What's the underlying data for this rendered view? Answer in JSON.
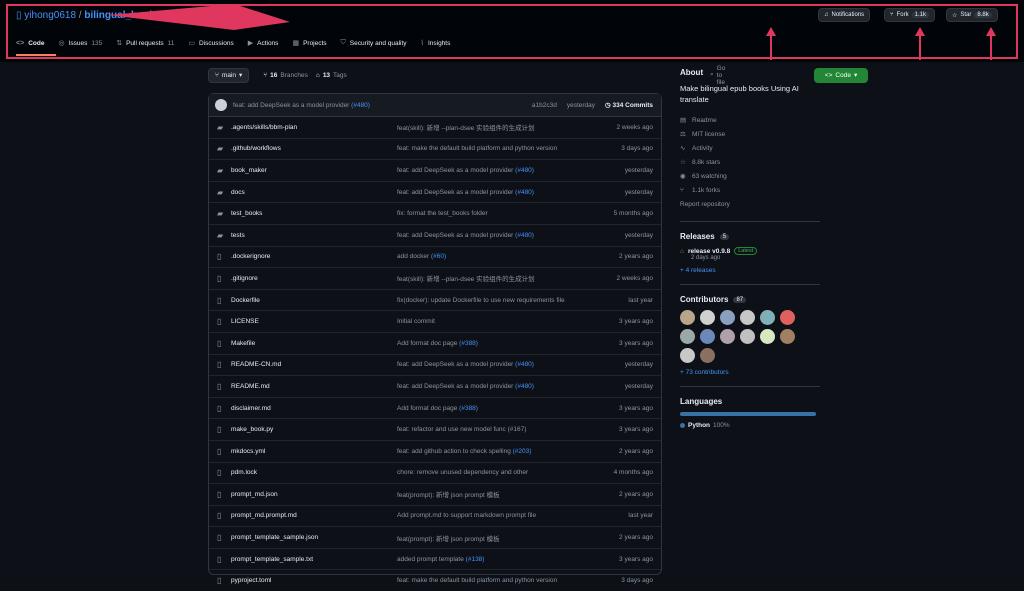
{
  "repo": {
    "owner": "yihong0618",
    "separator": "/",
    "name": "bilingual_book_maker"
  },
  "header_buttons": {
    "notifications": "Notifications",
    "fork_label": "Fork",
    "fork_count": "1.1k",
    "star_label": "Star",
    "star_count": "8.8k"
  },
  "tabs": [
    {
      "label": "Code",
      "count": ""
    },
    {
      "label": "Issues",
      "count": "135"
    },
    {
      "label": "Pull requests",
      "count": "11"
    },
    {
      "label": "Discussions",
      "count": ""
    },
    {
      "label": "Actions",
      "count": ""
    },
    {
      "label": "Projects",
      "count": ""
    },
    {
      "label": "Security and quality",
      "count": ""
    },
    {
      "label": "Insights",
      "count": ""
    }
  ],
  "branchbar": {
    "branch": "main",
    "branches_count": "16",
    "branches_label": "Branches",
    "tags_count": "13",
    "tags_label": "Tags",
    "goto_file": "Go to file",
    "code_button": "Code"
  },
  "latest_commit": {
    "author": "...",
    "message": "feat: add DeepSeek as a model provider",
    "pr": "(#480)",
    "hash": "a1b2c3d",
    "time": "yesterday",
    "commits": "334 Commits"
  },
  "files": [
    {
      "type": "dir",
      "name": ".agents/skills/bbm-plan",
      "msg": "feat(skill): 新增 --plan-dsee 实验组件的生成计划",
      "pr": "",
      "time": "2 weeks ago"
    },
    {
      "type": "dir",
      "name": ".github/workflows",
      "msg": "feat: make the default build platform and python version",
      "pr": "",
      "time": "3 days ago"
    },
    {
      "type": "dir",
      "name": "book_maker",
      "msg": "feat: add DeepSeek as a model provider",
      "pr": "(#480)",
      "time": "yesterday"
    },
    {
      "type": "dir",
      "name": "docs",
      "msg": "feat: add DeepSeek as a model provider",
      "pr": "(#480)",
      "time": "yesterday"
    },
    {
      "type": "dir",
      "name": "test_books",
      "msg": "fix: format the test_books folder",
      "pr": "",
      "time": "5 months ago"
    },
    {
      "type": "dir",
      "name": "tests",
      "msg": "feat: add DeepSeek as a model provider",
      "pr": "(#480)",
      "time": "yesterday"
    },
    {
      "type": "file",
      "name": ".dockerignore",
      "msg": "add docker",
      "pr": "(#60)",
      "time": "2 years ago"
    },
    {
      "type": "file",
      "name": ".gitignore",
      "msg": "feat(skill): 新增 --plan-dsee 实验组件的生成计划",
      "pr": "",
      "time": "2 weeks ago"
    },
    {
      "type": "file",
      "name": "Dockerfile",
      "msg": "fix(docker): update Dockerfile to use new requirements file",
      "pr": "",
      "time": "last year"
    },
    {
      "type": "file",
      "name": "LICENSE",
      "msg": "Initial commit",
      "pr": "",
      "time": "3 years ago"
    },
    {
      "type": "file",
      "name": "Makefile",
      "msg": "Add format doc page",
      "pr": "(#388)",
      "time": "3 years ago"
    },
    {
      "type": "file",
      "name": "README-CN.md",
      "msg": "feat: add DeepSeek as a model provider",
      "pr": "(#480)",
      "time": "yesterday"
    },
    {
      "type": "file",
      "name": "README.md",
      "msg": "feat: add DeepSeek as a model provider",
      "pr": "(#480)",
      "time": "yesterday"
    },
    {
      "type": "file",
      "name": "disclaimer.md",
      "msg": "Add format doc page",
      "pr": "(#388)",
      "time": "3 years ago"
    },
    {
      "type": "file",
      "name": "make_book.py",
      "msg": "feat: refactor and use new model func (#167)",
      "pr": "",
      "time": "3 years ago"
    },
    {
      "type": "file",
      "name": "mkdocs.yml",
      "msg": "feat: add github action to check spelling",
      "pr": "(#203)",
      "time": "2 years ago"
    },
    {
      "type": "file",
      "name": "pdm.lock",
      "msg": "chore: remove unused dependency and other",
      "pr": "",
      "time": "4 months ago"
    },
    {
      "type": "file",
      "name": "prompt_md.json",
      "msg": "feat(prompt): 新增 json prompt 模板",
      "pr": "",
      "time": "2 years ago"
    },
    {
      "type": "file",
      "name": "prompt_md.prompt.md",
      "msg": "Add prompt.md to support markdown prompt file",
      "pr": "",
      "time": "last year"
    },
    {
      "type": "file",
      "name": "prompt_template_sample.json",
      "msg": "feat(prompt): 新增 json prompt 模板",
      "pr": "",
      "time": "2 years ago"
    },
    {
      "type": "file",
      "name": "prompt_template_sample.txt",
      "msg": "added prompt template",
      "pr": "(#138)",
      "time": "3 years ago"
    },
    {
      "type": "file",
      "name": "pyproject.toml",
      "msg": "feat: make the default build platform and python version",
      "pr": "",
      "time": "3 days ago"
    }
  ],
  "about": {
    "heading": "About",
    "description": "Make bilingual epub books Using AI translate",
    "items": [
      {
        "icon": "book-icon",
        "label": "Readme"
      },
      {
        "icon": "law-icon",
        "label": "MIT license"
      },
      {
        "icon": "pulse-icon",
        "label": "Activity"
      },
      {
        "icon": "star-icon",
        "label": "8.8k stars"
      },
      {
        "icon": "eye-icon",
        "label": "63 watching"
      },
      {
        "icon": "fork-icon",
        "label": "1.1k forks"
      }
    ],
    "report": "Report repository"
  },
  "releases": {
    "heading": "Releases",
    "count": "5",
    "latest_name": "release v0.9.8",
    "latest_badge": "Latest",
    "latest_date": "2 days ago",
    "more": "+ 4 releases"
  },
  "contributors": {
    "heading": "Contributors",
    "count": "87",
    "avatar_colors": [
      "#b8a58a",
      "#d0d0d0",
      "#8aa0c0",
      "#c7c7c7",
      "#7fb0b8",
      "#e06060",
      "#9aa8a8",
      "#6a88b8",
      "#b0a0a8",
      "#c0c0c0",
      "#d8e8c0",
      "#a08060",
      "#c8c8c8",
      "#8a7060"
    ],
    "more": "+ 73 contributors"
  },
  "languages": {
    "heading": "Languages",
    "items": [
      {
        "name": "Python",
        "pct": "100%",
        "color": "#3572A5"
      }
    ]
  },
  "colors": {
    "accent": "#4493f8",
    "highlight": "#e0375f",
    "green": "#238636"
  }
}
